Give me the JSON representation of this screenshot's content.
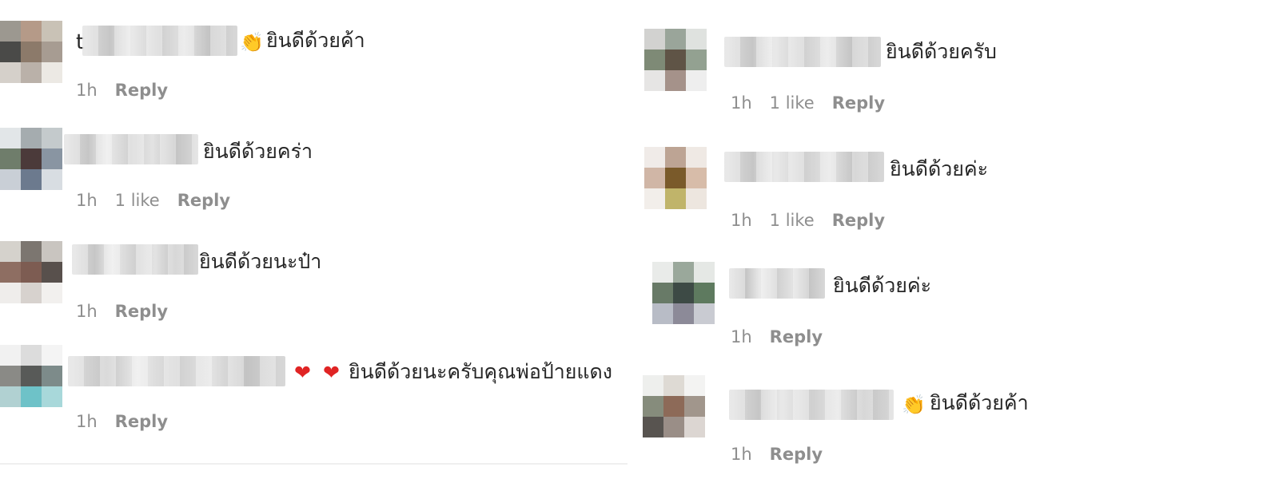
{
  "colors": {
    "text": "#262626",
    "meta": "#8e8e8e",
    "heart": "#e02424",
    "background": "#ffffff"
  },
  "comments": [
    {
      "lead_char": "t",
      "icon": "clapping-hands-icon",
      "emoji": "👏",
      "text": "ยินดีด้วยค้า",
      "time": "1h",
      "likes": "",
      "reply": "Reply"
    },
    {
      "text": "ยินดีด้วยคร่า",
      "time": "1h",
      "likes": "1 like",
      "reply": "Reply"
    },
    {
      "text": "ยินดีด้วยนะป๋า",
      "time": "1h",
      "likes": "",
      "reply": "Reply"
    },
    {
      "icons": [
        "heart-icon",
        "heart-icon"
      ],
      "heart": "❤",
      "text": "ยินดีด้วยนะครับคุณพ่อป้ายแดง",
      "time": "1h",
      "likes": "",
      "reply": "Reply"
    },
    {
      "text": "ยินดีด้วยครับ",
      "time": "1h",
      "likes": "1 like",
      "reply": "Reply"
    },
    {
      "text": "ยินดีด้วยค่ะ",
      "time": "1h",
      "likes": "1 like",
      "reply": "Reply"
    },
    {
      "text": "ยินดีด้วยค่ะ",
      "time": "1h",
      "likes": "",
      "reply": "Reply"
    },
    {
      "icon": "clapping-hands-icon",
      "emoji": "👏",
      "text": "ยินดีด้วยค้า",
      "time": "1h",
      "likes": "",
      "reply": "Reply"
    }
  ]
}
